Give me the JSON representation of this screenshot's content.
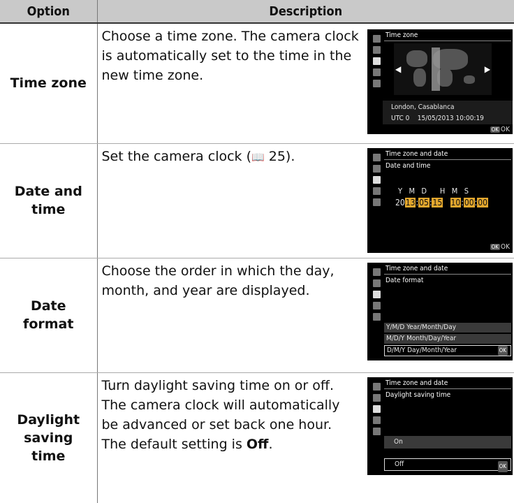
{
  "header": {
    "option": "Option",
    "description": "Description"
  },
  "rows": [
    {
      "option": "Time zone",
      "description": "Choose a time zone.  The camera clock is automatically set to the time in the new time zone.",
      "screen": {
        "title": "Time zone",
        "location": "London, Casablanca",
        "utc": "UTC 0",
        "datetime": "15/05/2013 10:00:19",
        "ok_icon": "OK",
        "ok_label": "OK",
        "arrow_left": "◀",
        "arrow_right": "▶"
      }
    },
    {
      "option_line1": "Date and",
      "option_line2": "time",
      "description_text": "Set the camera clock (",
      "ref_icon": "📖",
      "ref_page": " 25).",
      "screen": {
        "title": "Time zone and date",
        "subtitle": "Date and time",
        "labels": "Y   M   D      H   M   S",
        "year_prefix": "20",
        "year": "13",
        "month": "05",
        "day": "15",
        "hour": "10",
        "minute": "00",
        "second": "00",
        "ok_icon": "OK",
        "ok_label": "OK"
      }
    },
    {
      "option_line1": "Date",
      "option_line2": "format",
      "description": "Choose the order in which the day, month, and year are displayed.",
      "screen": {
        "title": "Time zone and date",
        "subtitle": "Date format",
        "items": [
          "Y/M/D Year/Month/Day",
          "M/D/Y Month/Day/Year",
          "D/M/Y Day/Month/Year"
        ],
        "ok_icon": "OK"
      }
    },
    {
      "option_line1": "Daylight",
      "option_line2": "saving",
      "option_line3": "time",
      "description_pre": "Turn daylight saving time on or off. The camera clock will automatically be advanced or set back one hour. The default setting is ",
      "description_bold": "Off",
      "description_post": ".",
      "screen": {
        "title": "Time zone and date",
        "subtitle": "Daylight saving time",
        "on": "On",
        "off": "Off",
        "ok_icon": "OK"
      }
    }
  ]
}
